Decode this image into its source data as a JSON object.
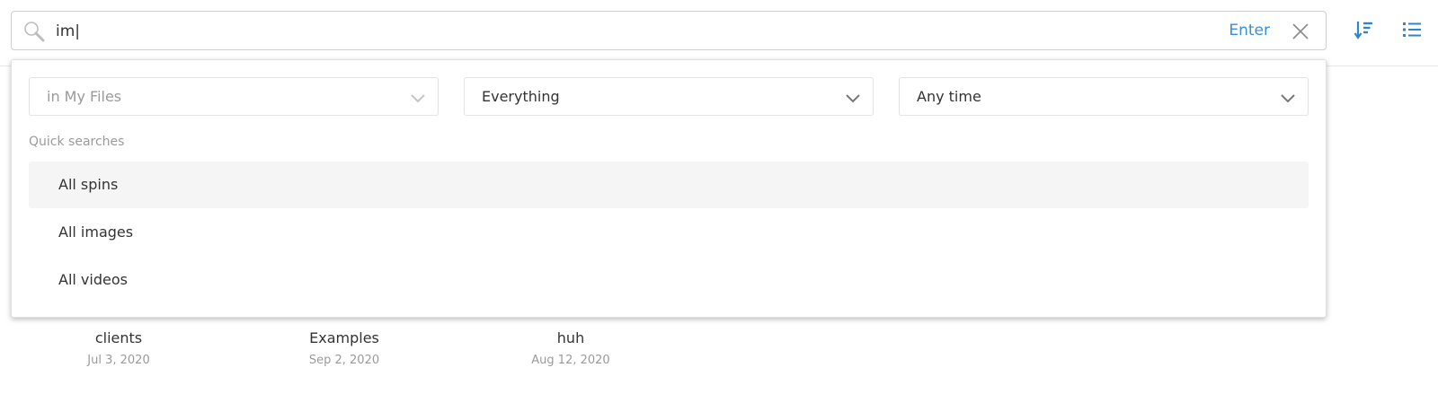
{
  "search": {
    "query": "im|",
    "enter_label": "Enter"
  },
  "filters": {
    "location": "in My Files",
    "type": "Everything",
    "time": "Any time"
  },
  "quick_searches": {
    "title": "Quick searches",
    "items": [
      {
        "label": "All spins"
      },
      {
        "label": "All images"
      },
      {
        "label": "All videos"
      }
    ]
  },
  "folders": [
    {
      "name": "clients",
      "date": "Jul 3, 2020"
    },
    {
      "name": "Examples",
      "date": "Sep 2, 2020"
    },
    {
      "name": "huh",
      "date": "Aug 12, 2020"
    }
  ],
  "colors": {
    "accent": "#3a8fcf",
    "muted_text": "#9a9a9a",
    "hover_bg": "#f5f5f5"
  }
}
